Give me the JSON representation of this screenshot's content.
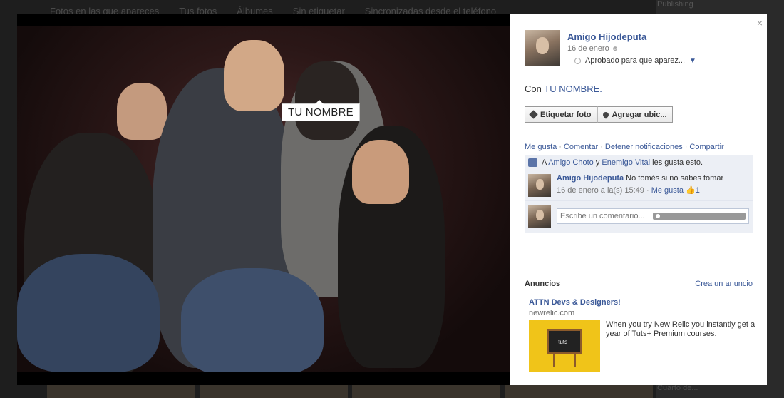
{
  "background": {
    "tabs": [
      "Fotos en las que apareces",
      "Tus fotos",
      "Álbumes",
      "Sin etiquetar",
      "Sincronizadas desde el teléfono"
    ],
    "side_top": "Publishing",
    "side_bottom": "Cuarto de..."
  },
  "photo": {
    "tag_label": "TU NOMBRE"
  },
  "panel": {
    "close": "×",
    "author": {
      "name": "Amigo Hijodeputa",
      "date": "16 de enero",
      "audience": "Aprobado para que aparez..."
    },
    "with_prefix": "Con",
    "with_name": "TU NOMBRE.",
    "actions": {
      "tag_photo": "Etiquetar foto",
      "add_location": "Agregar ubic..."
    },
    "ufi_links": [
      "Me gusta",
      "Comentar",
      "Detener notificaciones",
      "Compartir"
    ],
    "likes": {
      "prefix": "A",
      "user1": "Amigo Choto",
      "joiner": "y",
      "user2": "Enemigo Vital",
      "suffix": "les gusta esto."
    },
    "comment": {
      "author": "Amigo Hijodeputa",
      "text": "No tomés si no sabes tomar",
      "meta": "16 de enero a la(s) 15:49 ·",
      "like_link": "Me gusta",
      "like_count": "1"
    },
    "comment_placeholder": "Escribe un comentario...",
    "ads": {
      "header": "Anuncios",
      "create": "Crea un anuncio",
      "title": "ATTN Devs & Designers!",
      "domain": "newrelic.com",
      "body": "When you try New Relic you instantly get a year of Tuts+ Premium courses.",
      "board_text": "tuts+"
    }
  }
}
